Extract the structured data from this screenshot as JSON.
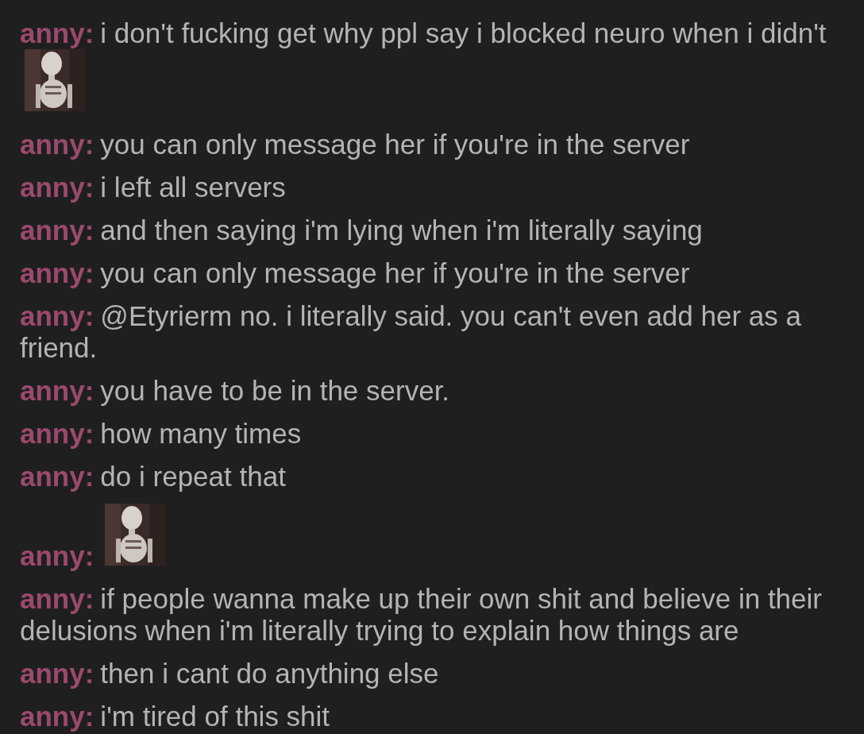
{
  "messages": [
    {
      "author": "anny:",
      "text": "i don't fucking get why ppl say i blocked neuro when i didn't"
    },
    {
      "author": "anny:",
      "text": "you can only message her if you're in the server"
    },
    {
      "author": "anny:",
      "text": "i left all servers"
    },
    {
      "author": "anny:",
      "text": "and then saying i'm lying when i'm literally saying"
    },
    {
      "author": "anny:",
      "text": "you can only message her if you're in the server"
    },
    {
      "author": "anny:",
      "text": "@Etyrierm no. i literally said. you can't even add her as a friend."
    },
    {
      "author": "anny:",
      "text": "you have to be in the server."
    },
    {
      "author": "anny:",
      "text": "how many times"
    },
    {
      "author": "anny:",
      "text": "do i repeat that"
    },
    {
      "author": "anny:"
    },
    {
      "author": "anny:",
      "text": "if people wanna make up their own shit and believe in their delusions when i'm literally trying to explain how things are"
    },
    {
      "author": "anny:",
      "text": "then i cant do anything else"
    },
    {
      "author": "anny:",
      "text": "i'm tired of this shit"
    }
  ]
}
